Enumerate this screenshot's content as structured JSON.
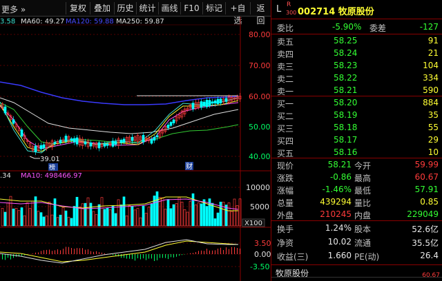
{
  "toolbar": {
    "more": "更多 »",
    "buttons": [
      "复权",
      "叠加",
      "历史",
      "统计",
      "画线",
      "F10",
      "标记",
      "+自选",
      "返回"
    ]
  },
  "chart": {
    "ma_legend": {
      "ma20_partial": "3.58",
      "ma60": "MA60: 49.27",
      "ma120": "MA120: 59.88",
      "ma250": "MA250: 59.87"
    },
    "price_axis": [
      "80.00",
      "70.00",
      "60.00",
      "50.00",
      "40.00"
    ],
    "low_marker": "39.01",
    "marker_bang": "榜",
    "marker_cai": "财",
    "vol_legend": {
      "vol": ".34",
      "ma10": "MA10: 498466.97"
    },
    "vol_axis": [
      "10000",
      "5000"
    ],
    "vol_unit": "X100",
    "macd_axis": [
      "3.50",
      "0.00",
      "-3.50"
    ]
  },
  "panel": {
    "header": {
      "L": "L",
      "R": "R",
      "n300": "300",
      "code": "002714 牧原股份"
    },
    "weibi": {
      "label": "委比",
      "value": "-5.90%",
      "label2": "委差",
      "value2": "-127"
    },
    "sells": [
      {
        "label": "卖五",
        "price": "58.25",
        "vol": "91"
      },
      {
        "label": "卖四",
        "price": "58.24",
        "vol": "21"
      },
      {
        "label": "卖三",
        "price": "58.23",
        "vol": "104"
      },
      {
        "label": "卖二",
        "price": "58.22",
        "vol": "334"
      },
      {
        "label": "卖一",
        "price": "58.21",
        "vol": "590"
      }
    ],
    "buys": [
      {
        "label": "买一",
        "price": "58.20",
        "vol": "884"
      },
      {
        "label": "买二",
        "price": "58.19",
        "vol": "35"
      },
      {
        "label": "买三",
        "price": "58.18",
        "vol": "55"
      },
      {
        "label": "买四",
        "price": "58.17",
        "vol": "29"
      },
      {
        "label": "买五",
        "price": "58.16",
        "vol": "10"
      }
    ],
    "stats": [
      {
        "l1": "现价",
        "v1": "58.21",
        "l2": "今开",
        "v2": "59.99"
      },
      {
        "l1": "涨跌",
        "v1": "-0.86",
        "l2": "最高",
        "v2": "60.67"
      },
      {
        "l1": "涨幅",
        "v1": "-1.46%",
        "l2": "最低",
        "v2": "57.91"
      },
      {
        "l1": "总量",
        "v1": "439294",
        "l2": "量比",
        "v2": "0.85"
      },
      {
        "l1": "外盘",
        "v1": "210245",
        "l2": "内盘",
        "v2": "229049"
      }
    ],
    "stats2": [
      {
        "l1": "换手",
        "v1": "1.24%",
        "l2": "股本",
        "v2": "52.6亿"
      },
      {
        "l1": "净资",
        "v1": "10.02",
        "l2": "流通",
        "v2": "35.5亿"
      },
      {
        "l1": "收益(三)",
        "v1": "1.660",
        "l2": "PE(动)",
        "v2": "26.4"
      }
    ],
    "mini_title": "牧原股份",
    "mini_value": "60.67"
  },
  "colors": {
    "up": "#ff3b3b",
    "down": "#00ffff",
    "accent": "#ffff33",
    "border": "#8b0000"
  }
}
